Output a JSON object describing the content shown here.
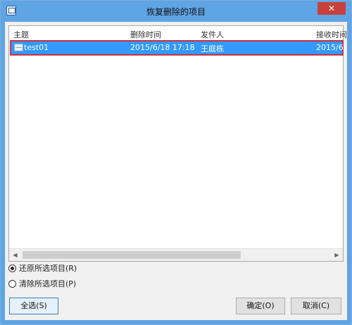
{
  "window": {
    "title": "恢复删除的项目",
    "close_label": "✕"
  },
  "list": {
    "columns": [
      "主题",
      "删除时间",
      "发件人",
      "接收时间"
    ],
    "rows": [
      {
        "subject": "test01",
        "deleted_time": "2015/6/18 17:18",
        "sender": "王庭栋",
        "received_time": "2015/6/"
      }
    ]
  },
  "options": {
    "restore_label": "还原所选项目(R)",
    "purge_label": "清除所选项目(P)",
    "selected": "restore"
  },
  "buttons": {
    "select_all": "全选(S)",
    "ok": "确定(O)",
    "cancel": "取消(C)"
  },
  "icons": {
    "scroll_left": "◀",
    "scroll_right": "▶"
  },
  "colors": {
    "titlebar": "#5fa4e4",
    "selection": "#3399ff",
    "highlight_border": "#d0303a"
  }
}
